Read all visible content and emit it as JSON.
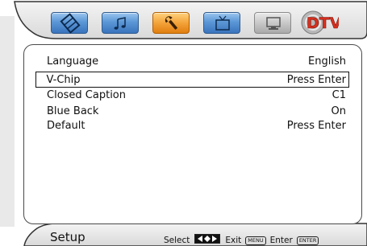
{
  "tabs": [
    {
      "name": "picture",
      "icon": "film-strip-icon",
      "state": "normal"
    },
    {
      "name": "audio",
      "icon": "music-note-icon",
      "state": "normal"
    },
    {
      "name": "setup",
      "icon": "wrench-icon",
      "state": "active"
    },
    {
      "name": "tv",
      "icon": "tv-icon",
      "state": "normal"
    },
    {
      "name": "pc",
      "icon": "monitor-icon",
      "state": "disabled"
    }
  ],
  "logo": {
    "text": "DTV"
  },
  "menu": {
    "items": [
      {
        "label": "Language",
        "value": "English"
      },
      {
        "label": "V-Chip",
        "value": "Press Enter"
      },
      {
        "label": "Closed Caption",
        "value": "C1"
      },
      {
        "label": "Blue Back",
        "value": "On"
      },
      {
        "label": "Default",
        "value": "Press Enter"
      }
    ],
    "selected_index": 1
  },
  "status": {
    "title": "Setup",
    "select_label": "Select",
    "exit_label": "Exit",
    "menu_key": "MENU",
    "enter_label": "Enter",
    "enter_key": "ENTER"
  },
  "colors": {
    "tab_blue": "#5b97d6",
    "tab_active": "#f3a33a",
    "tab_disabled": "#c2c2c2",
    "logo_red": "#d8301e",
    "frame": "#e9e9e9"
  }
}
